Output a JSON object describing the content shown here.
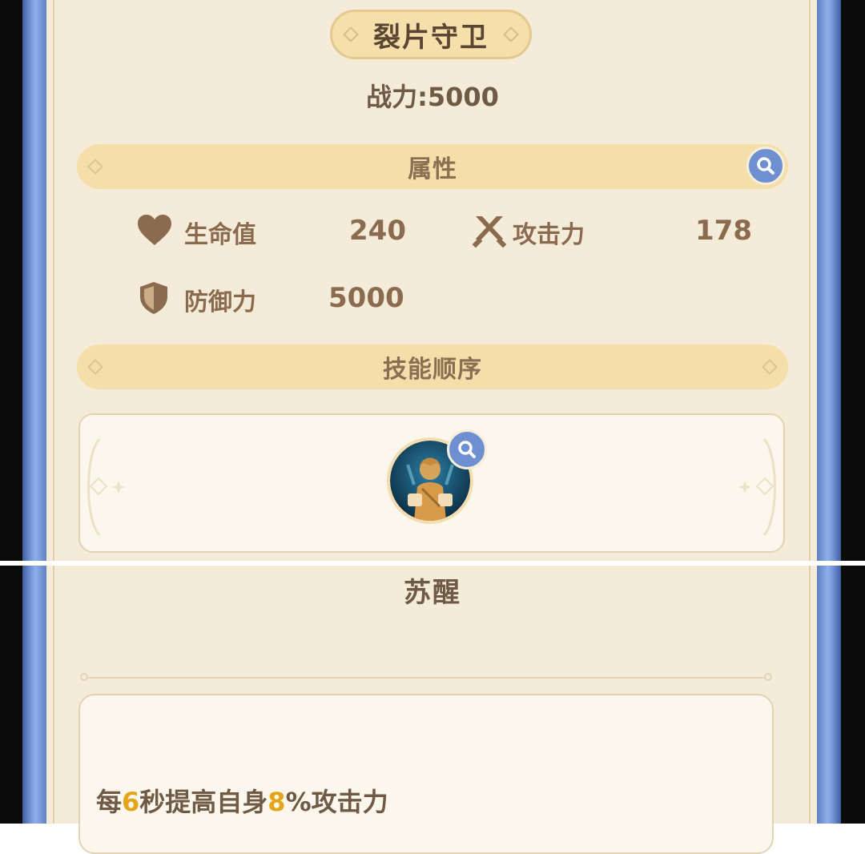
{
  "header": {
    "title": "裂片守卫",
    "power_text": "战力:5000"
  },
  "attributes": {
    "section_label": "属性",
    "stats": [
      {
        "icon": "heart-icon",
        "label": "生命值",
        "value": "240"
      },
      {
        "icon": "swords-icon",
        "label": "攻击力",
        "value": "178"
      },
      {
        "icon": "shield-icon",
        "label": "防御力",
        "value": "5000"
      }
    ]
  },
  "skills": {
    "section_label": "技能顺序"
  },
  "skill_detail": {
    "name": "苏醒",
    "description_parts": [
      "每",
      "6",
      "秒提高自身",
      "8",
      "%攻击力"
    ]
  },
  "colors": {
    "parchment": "#f4ecd9",
    "section_bar": "#f4dfaa",
    "frame_blue": "#6d8fd2",
    "text_brown": "#8b6b50",
    "highlight_orange": "#e5a51a"
  }
}
